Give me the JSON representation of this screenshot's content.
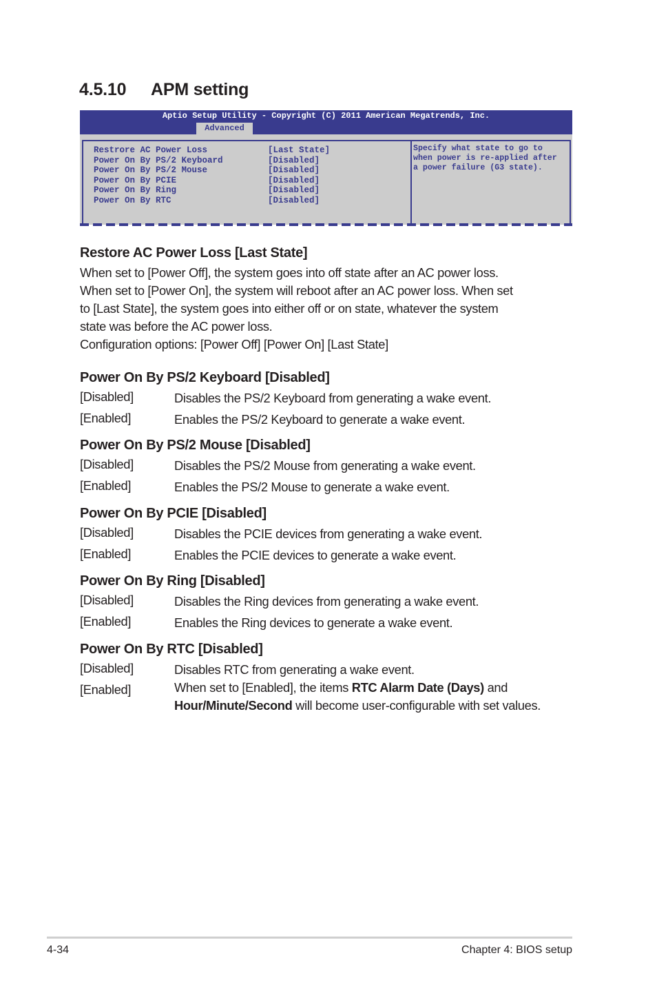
{
  "section": {
    "number": "4.5.10",
    "title": "APM setting"
  },
  "bios": {
    "title": "Aptio Setup Utility - Copyright (C) 2011 American Megatrends, Inc.",
    "active_tab": "Advanced",
    "items": [
      {
        "label": "Restrore AC Power Loss",
        "value": "[Last State]"
      },
      {
        "label": "Power On By PS/2 Keyboard",
        "value": "[Disabled]"
      },
      {
        "label": "Power On By PS/2 Mouse",
        "value": "[Disabled]"
      },
      {
        "label": "Power On By PCIE",
        "value": "[Disabled]"
      },
      {
        "label": "Power On By Ring",
        "value": "[Disabled]"
      },
      {
        "label": "Power On By RTC",
        "value": "[Disabled]"
      }
    ],
    "help_lines": [
      "Specify what state to go to",
      "when power is re-applied after",
      "a power failure (G3 state)."
    ],
    "colors": {
      "header": "#393b8e",
      "body": "#cccccc",
      "text": "#393b8e"
    }
  },
  "restore": {
    "heading": "Restore AC Power Loss [Last State]",
    "lines": [
      "When set to [Power Off], the system goes into off state after an AC power loss.",
      "When set to [Power On], the system will reboot after an AC power loss. When set",
      "to [Last State], the system goes into either off or on state, whatever the system",
      "state was before the AC power loss.",
      "Configuration options: [Power Off] [Power On] [Last State]"
    ]
  },
  "options": [
    {
      "heading": "Power On By PS/2 Keyboard [Disabled]",
      "rows": [
        {
          "key": "[Disabled]",
          "desc": "Disables the PS/2 Keyboard from generating a wake event."
        },
        {
          "key": "[Enabled]",
          "desc": "Enables the PS/2 Keyboard to generate a wake event."
        }
      ]
    },
    {
      "heading": "Power On By PS/2 Mouse [Disabled]",
      "rows": [
        {
          "key": "[Disabled]",
          "desc": "Disables the PS/2 Mouse from generating a wake event."
        },
        {
          "key": "[Enabled]",
          "desc": "Enables the PS/2 Mouse to generate a wake event."
        }
      ]
    },
    {
      "heading": "Power On By PCIE [Disabled]",
      "rows": [
        {
          "key": "[Disabled]",
          "desc": "Disables the PCIE devices from generating a wake event."
        },
        {
          "key": "[Enabled]",
          "desc": "Enables the PCIE devices to generate a wake event."
        }
      ]
    },
    {
      "heading": "Power On By Ring [Disabled]",
      "rows": [
        {
          "key": "[Disabled]",
          "desc": "Disables the Ring devices from generating a wake event."
        },
        {
          "key": "[Enabled]",
          "desc": "Enables the Ring devices to generate a wake event."
        }
      ]
    },
    {
      "heading": "Power On By RTC [Disabled]",
      "rows": [
        {
          "key": "[Disabled]",
          "desc": "Disables RTC from generating a wake event."
        },
        {
          "key": "[Enabled]",
          "desc_parts": [
            "When set to [Enabled], the items ",
            "RTC Alarm Date (Days)",
            " and ",
            "Hour/Minute/Second",
            " will become user-configurable with set values."
          ]
        }
      ]
    }
  ],
  "footer": {
    "page": "4-34",
    "chapter": "Chapter 4: BIOS setup"
  }
}
